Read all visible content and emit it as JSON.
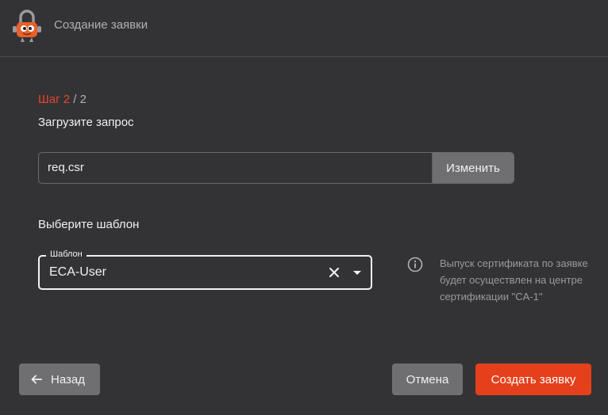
{
  "header": {
    "title": "Создание заявки",
    "logo_icon": "padlock-mascot-logo"
  },
  "step": {
    "current": "Шаг 2",
    "separator_total": " / 2"
  },
  "upload": {
    "title": "Загрузите запрос",
    "file_name": "req.csr",
    "change_label": "Изменить"
  },
  "template": {
    "title": "Выберите шаблон",
    "field_label": "Шаблон",
    "value": "ECA-User",
    "info_text": "Выпуск сертификата по заявке будет осуществлен на центре сертификации \"CA-1\""
  },
  "footer": {
    "back_label": "Назад",
    "cancel_label": "Отмена",
    "create_label": "Создать заявку"
  },
  "colors": {
    "accent": "#e5401c",
    "background": "#333335",
    "secondary_button": "#6f6f72"
  }
}
